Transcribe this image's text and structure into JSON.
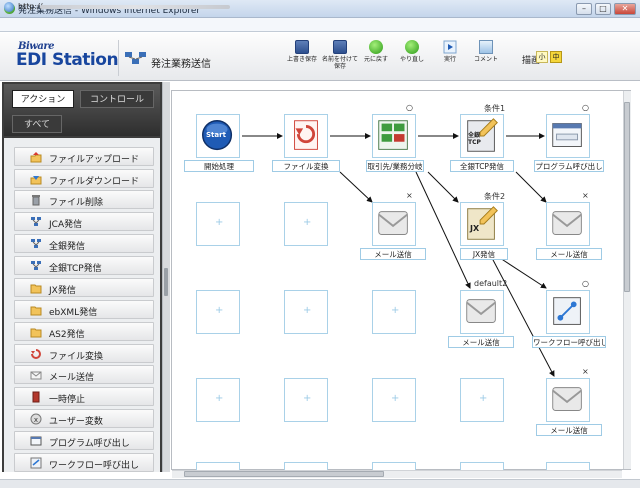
{
  "window": {
    "title": "発注業務送信 - Windows Internet Explorer",
    "address": "http://",
    "buttons": {
      "minimize": "–",
      "maximize": "□",
      "close": "✕"
    }
  },
  "header": {
    "logo_brand": "Biware",
    "logo_main": "EDI Station",
    "page_title": "発注業務送信"
  },
  "toolbar": {
    "overwrite_save": "上書き保存",
    "save_as": "名前を付けて保存",
    "undo": "元に戻す",
    "redo": "やり直し",
    "run": "実行",
    "comment": "コメント",
    "zoom_label": "描画:",
    "zoom_small": "小",
    "zoom_medium": "中"
  },
  "left_panel": {
    "tabs": {
      "action": "アクション",
      "control": "コントロール",
      "all": "すべて"
    },
    "items": [
      {
        "label": "ファイルアップロード",
        "icon": "upload-icon"
      },
      {
        "label": "ファイルダウンロード",
        "icon": "download-icon"
      },
      {
        "label": "ファイル削除",
        "icon": "trash-icon"
      },
      {
        "label": "JCA発信",
        "icon": "network-icon"
      },
      {
        "label": "全銀発信",
        "icon": "network-icon"
      },
      {
        "label": "全銀TCP発信",
        "icon": "network-icon"
      },
      {
        "label": "JX発信",
        "icon": "folder-icon"
      },
      {
        "label": "ebXML発信",
        "icon": "folder-icon"
      },
      {
        "label": "AS2発信",
        "icon": "folder-icon"
      },
      {
        "label": "ファイル変換",
        "icon": "convert-icon"
      },
      {
        "label": "メール送信",
        "icon": "mail-icon"
      },
      {
        "label": "一時停止",
        "icon": "pause-icon"
      },
      {
        "label": "ユーザー変数",
        "icon": "variable-icon"
      },
      {
        "label": "プログラム呼び出し",
        "icon": "program-icon"
      },
      {
        "label": "ワークフロー呼び出し",
        "icon": "workflow-icon"
      }
    ]
  },
  "flow": {
    "nodes": [
      {
        "id": "start",
        "label": "開始処理",
        "icon": "start-icon",
        "marker": ""
      },
      {
        "id": "convert",
        "label": "ファイル変換",
        "icon": "convert-icon",
        "marker": ""
      },
      {
        "id": "branch",
        "label": "取引先/業務分岐",
        "icon": "branch-icon",
        "marker": "○"
      },
      {
        "id": "zengin",
        "label": "全銀TCP発信",
        "icon": "zengin-tcp-icon",
        "marker": "条件1",
        "badge": "全銀 TCP"
      },
      {
        "id": "program",
        "label": "プログラム呼び出し",
        "icon": "program-icon",
        "marker": "○"
      },
      {
        "id": "mail1",
        "label": "メール送信",
        "icon": "mail-icon",
        "marker": "×"
      },
      {
        "id": "jx",
        "label": "JX発信",
        "icon": "jx-icon",
        "marker": "条件2",
        "badge": "JX"
      },
      {
        "id": "mail2",
        "label": "メール送信",
        "icon": "mail-icon",
        "marker": "×"
      },
      {
        "id": "mail3",
        "label": "メール送信",
        "icon": "mail-icon",
        "marker": "default2"
      },
      {
        "id": "workflow",
        "label": "ワークフロー呼び出し",
        "icon": "workflow-icon",
        "marker": "○"
      },
      {
        "id": "mail4",
        "label": "メール送信",
        "icon": "mail-icon",
        "marker": "×"
      }
    ],
    "start_label": "Start",
    "empty_slot_symbol": "+"
  },
  "colors": {
    "accent_blue": "#18469e",
    "panel_dark": "#3d3d3d",
    "node_border": "#a9d1e8",
    "start_button": "#1f5bb5",
    "zoom_active": "#f5d63a"
  }
}
